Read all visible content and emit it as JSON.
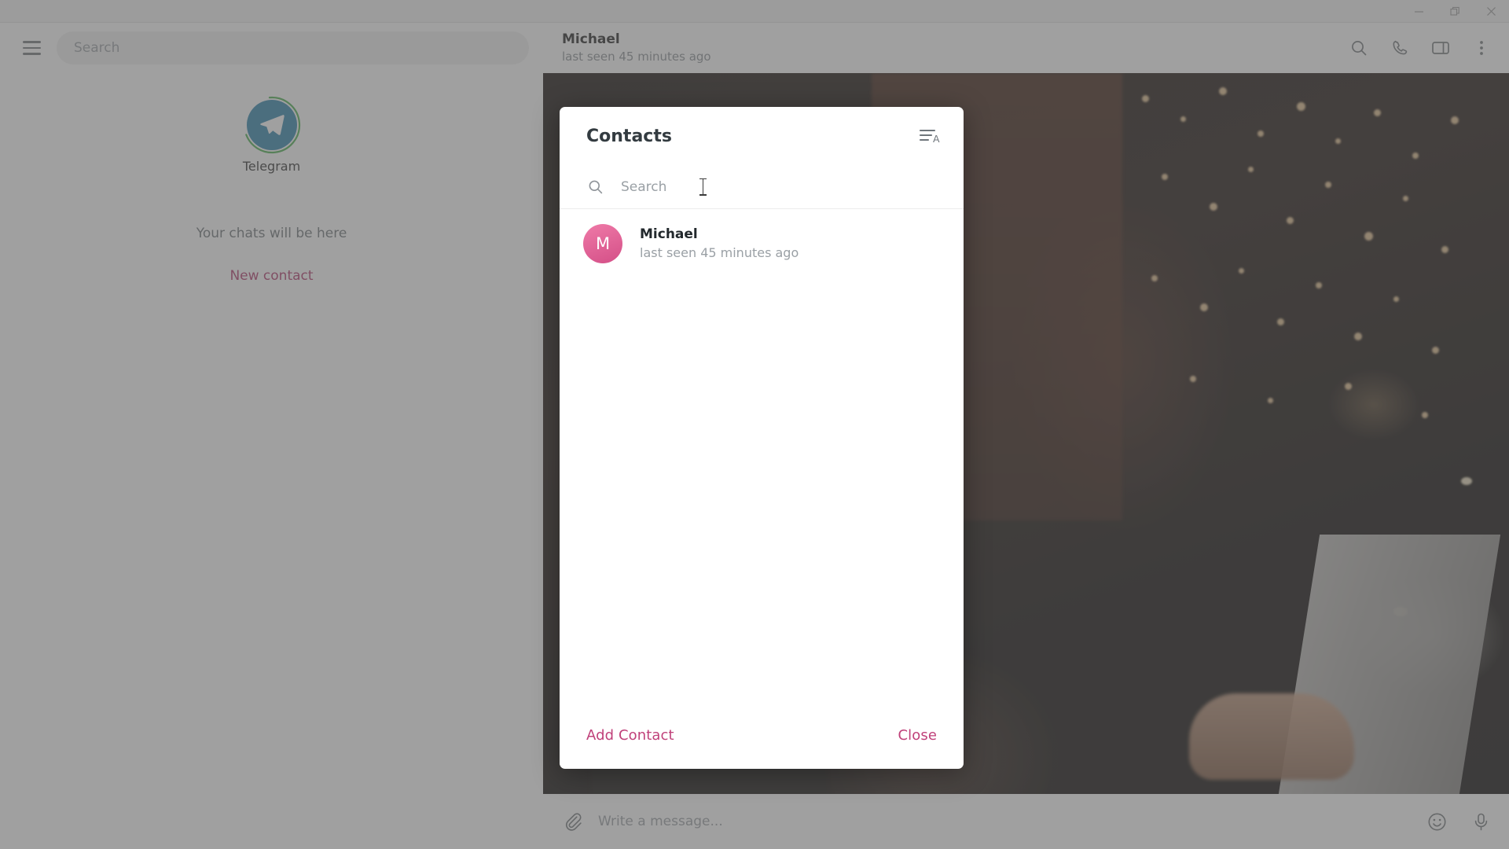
{
  "window": {
    "minimize_label": "Minimize",
    "restore_label": "Restore",
    "close_label": "Close"
  },
  "sidebar": {
    "menu_icon": "hamburger-menu-icon",
    "search_placeholder": "Search",
    "logo_label": "Telegram",
    "empty_text": "Your chats will be here",
    "new_contact_label": "New contact"
  },
  "chat": {
    "name": "Michael",
    "status": "last seen 45 minutes ago",
    "icons": [
      "search-icon",
      "phone-call-icon",
      "toggle-panel-icon",
      "more-vertical-icon"
    ],
    "composer": {
      "attach_icon": "paperclip-icon",
      "placeholder": "Write a message...",
      "emoji_icon": "emoji-smiley-icon",
      "mic_icon": "microphone-icon"
    }
  },
  "dialog": {
    "title": "Contacts",
    "sort_icon": "sort-alphabetical-icon",
    "search_placeholder": "Search",
    "search_value": "",
    "contacts": [
      {
        "initial": "M",
        "name": "Michael",
        "status": "last seen 45 minutes ago"
      }
    ],
    "add_contact_label": "Add Contact",
    "close_label": "Close"
  },
  "colors": {
    "accent_pink": "#c0417a",
    "avatar_pink": "#e5679b",
    "telegram_blue": "#2b82ab",
    "ring_green": "#4aae4f"
  }
}
